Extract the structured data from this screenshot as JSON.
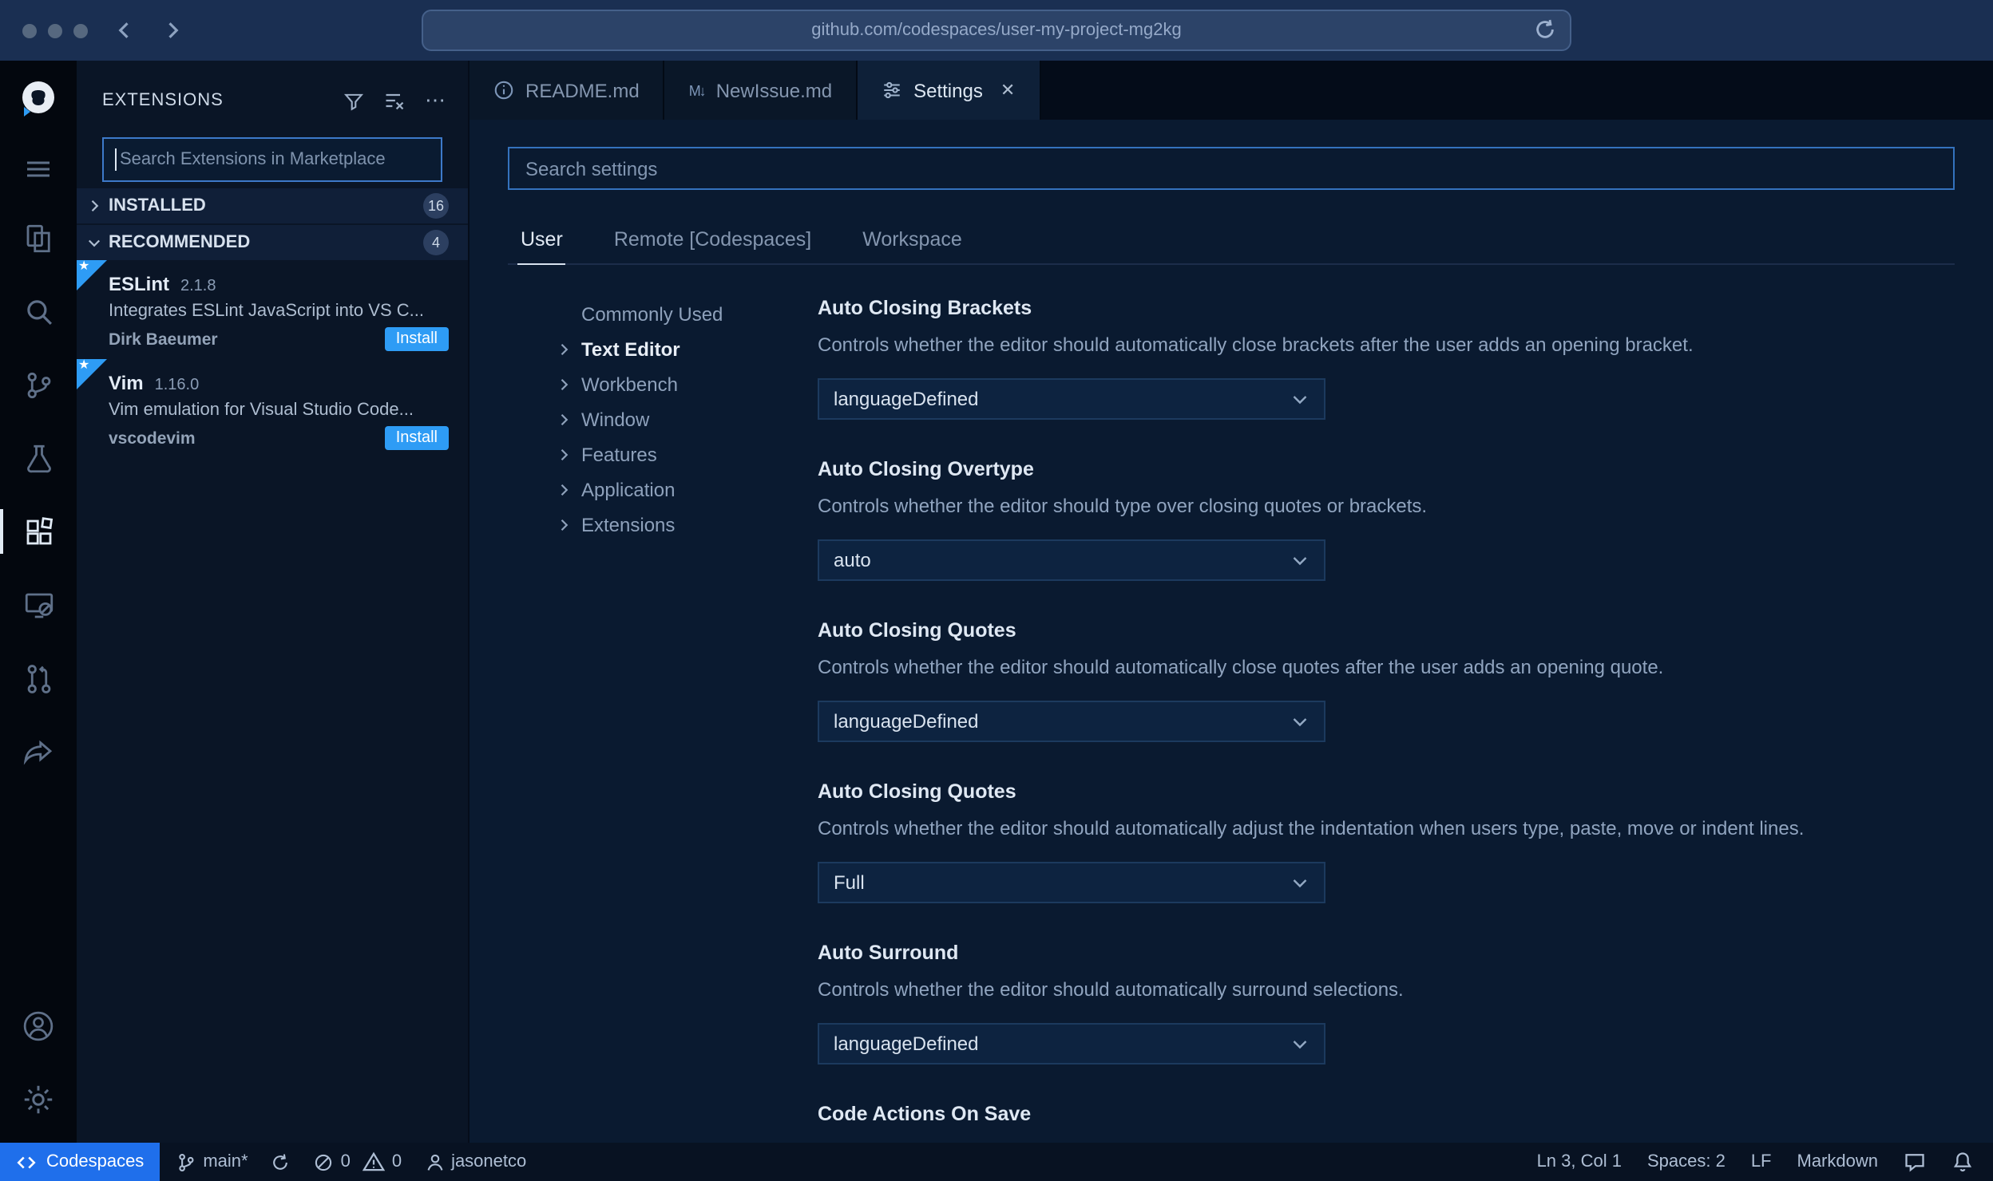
{
  "colors": {
    "accent_blue": "#2e9cf5",
    "codespaces_blue": "#1f6feb",
    "editor_bg": "#0a1a30",
    "activity_bg": "#03070e",
    "chrome_bg": "#1a2f52"
  },
  "icons": {
    "ellipsis": "⋯",
    "close": "✕",
    "markdown_glyph": "M↓",
    "star": "★"
  },
  "browser": {
    "url": "github.com/codespaces/user-my-project-mg2kg"
  },
  "sidebar": {
    "title": "EXTENSIONS",
    "search_placeholder": "Search Extensions in Marketplace",
    "sections": [
      {
        "label": "INSTALLED",
        "count": "16"
      },
      {
        "label": "RECOMMENDED",
        "count": "4"
      }
    ],
    "extensions": [
      {
        "name": "ESLint",
        "version": "2.1.8",
        "description": "Integrates ESLint JavaScript into VS C...",
        "publisher": "Dirk Baeumer",
        "action": "Install"
      },
      {
        "name": "Vim",
        "version": "1.16.0",
        "description": "Vim emulation for Visual Studio Code...",
        "publisher": "vscodevim",
        "action": "Install"
      }
    ]
  },
  "tabs": [
    {
      "label": "README.md"
    },
    {
      "label": "NewIssue.md"
    },
    {
      "label": "Settings"
    }
  ],
  "settings": {
    "search_placeholder": "Search settings",
    "scopes": [
      {
        "label": "User"
      },
      {
        "label": "Remote [Codespaces]"
      },
      {
        "label": "Workspace"
      }
    ],
    "toc": [
      {
        "label": "Commonly Used"
      },
      {
        "label": "Text Editor"
      },
      {
        "label": "Workbench"
      },
      {
        "label": "Window"
      },
      {
        "label": "Features"
      },
      {
        "label": "Application"
      },
      {
        "label": "Extensions"
      }
    ],
    "items": [
      {
        "title": "Auto Closing Brackets",
        "description": "Controls whether the editor should automatically close brackets after the user adds an opening bracket.",
        "value": "languageDefined"
      },
      {
        "title": "Auto Closing Overtype",
        "description": "Controls whether the editor should type over closing quotes or brackets.",
        "value": "auto"
      },
      {
        "title": "Auto Closing Quotes",
        "description": "Controls whether the editor should automatically close quotes after the user adds an opening quote.",
        "value": "languageDefined"
      },
      {
        "title": "Auto Closing Quotes",
        "description": "Controls whether the editor should automatically adjust the indentation when users type, paste, move or indent lines.",
        "value": "Full"
      },
      {
        "title": "Auto Surround",
        "description": "Controls whether the editor should automatically surround selections.",
        "value": "languageDefined"
      },
      {
        "title": "Code Actions On Save"
      }
    ]
  },
  "status_bar": {
    "codespaces": "Codespaces",
    "branch": "main*",
    "errors": "0",
    "warnings": "0",
    "user": "jasonetco",
    "cursor": "Ln 3, Col 1",
    "indent": "Spaces: 2",
    "eol": "LF",
    "language": "Markdown"
  }
}
